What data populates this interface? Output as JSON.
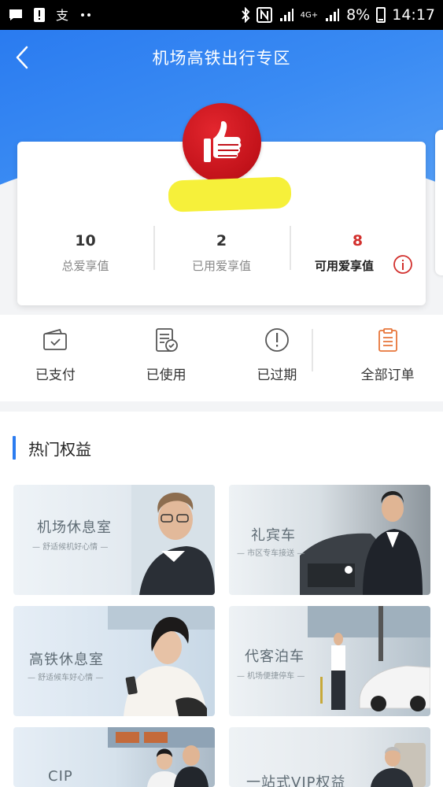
{
  "status_bar": {
    "battery_percent": "8%",
    "time": "14:17",
    "network": "4G+",
    "left_icons": [
      "message-icon",
      "alert-icon",
      "alipay-icon",
      "dots-icon"
    ],
    "right_icons": [
      "bluetooth-icon",
      "nfc-icon",
      "signal-icon",
      "signal-icon",
      "battery-icon"
    ]
  },
  "header": {
    "title": "机场高铁出行专区",
    "back_icon": "chevron-left-icon"
  },
  "profile": {
    "avatar_icon": "thumbs-up-icon",
    "stats": [
      {
        "value": "10",
        "label": "总爱享值"
      },
      {
        "value": "2",
        "label": "已用爱享值"
      },
      {
        "value": "8",
        "label": "可用爱享值"
      }
    ],
    "info_icon": "info-icon"
  },
  "orders": [
    {
      "label": "已支付",
      "icon": "wallet-check-icon"
    },
    {
      "label": "已使用",
      "icon": "document-check-icon"
    },
    {
      "label": "已过期",
      "icon": "exclamation-circle-icon"
    },
    {
      "label": "全部订单",
      "icon": "clipboard-list-icon"
    }
  ],
  "section": {
    "title": "热门权益",
    "tiles": [
      {
        "title": "机场休息室",
        "subtitle": "— 舒适候机好心情 —"
      },
      {
        "title": "礼宾车",
        "subtitle": "— 市区专车接送 —"
      },
      {
        "title": "高铁休息室",
        "subtitle": "— 舒适候车好心情 —"
      },
      {
        "title": "代客泊车",
        "subtitle": "— 机场便捷停车 —"
      },
      {
        "title": "CIP",
        "subtitle": ""
      },
      {
        "title": "一站式VIP权益",
        "subtitle": ""
      }
    ]
  },
  "colors": {
    "primary_blue": "#2b7cf0",
    "highlight_red": "#d2302d",
    "avatar_red": "#c2121a",
    "order_accent": "#e8763a"
  }
}
